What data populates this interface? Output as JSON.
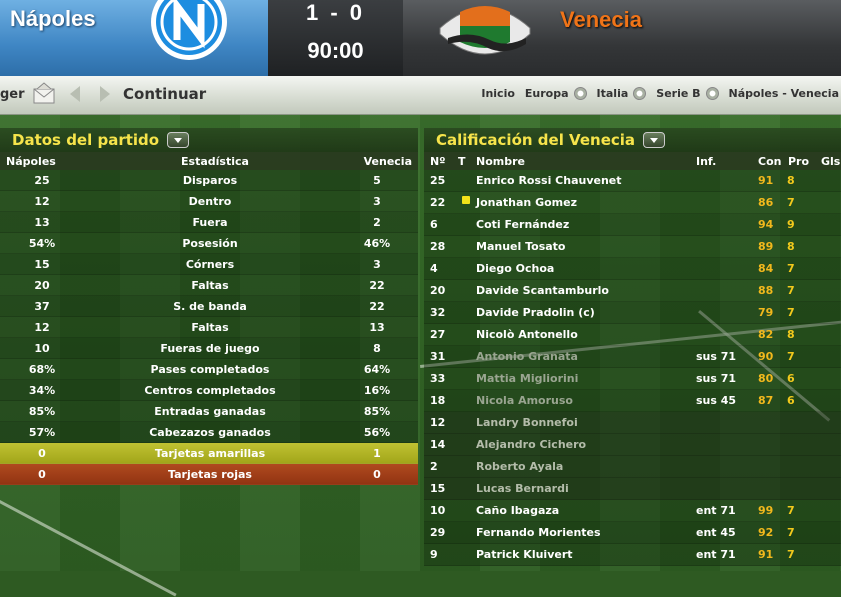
{
  "scoreboard": {
    "home_team": "Nápoles",
    "away_team": "Venecia",
    "score": "1 - 0",
    "clock": "90:00",
    "colors": {
      "home": "#3f86c4",
      "away_text": "#f07418"
    }
  },
  "nav": {
    "manager_fragment": "ger",
    "continue_label": "Continuar",
    "breadcrumbs": [
      "Inicio",
      "Europa",
      "Italia",
      "Serie B",
      "Nápoles - Venecia"
    ]
  },
  "stats_panel": {
    "title": "Datos del partido",
    "headers": {
      "home": "Nápoles",
      "stat": "Estadística",
      "away": "Venecia"
    },
    "rows": [
      {
        "home": "25",
        "stat": "Disparos",
        "away": "5"
      },
      {
        "home": "12",
        "stat": "Dentro",
        "away": "3"
      },
      {
        "home": "13",
        "stat": "Fuera",
        "away": "2"
      },
      {
        "home": "54%",
        "stat": "Posesión",
        "away": "46%"
      },
      {
        "home": "15",
        "stat": "Córners",
        "away": "3"
      },
      {
        "home": "20",
        "stat": "Faltas",
        "away": "22"
      },
      {
        "home": "37",
        "stat": "S. de banda",
        "away": "22"
      },
      {
        "home": "12",
        "stat": "Faltas",
        "away": "13"
      },
      {
        "home": "10",
        "stat": "Fueras de juego",
        "away": "8"
      },
      {
        "home": "68%",
        "stat": "Pases completados",
        "away": "64%"
      },
      {
        "home": "34%",
        "stat": "Centros completados",
        "away": "16%"
      },
      {
        "home": "85%",
        "stat": "Entradas ganadas",
        "away": "85%"
      },
      {
        "home": "57%",
        "stat": "Cabezazos ganados",
        "away": "56%"
      },
      {
        "home": "0",
        "stat": "Tarjetas amarillas",
        "away": "1",
        "highlight": "yellow"
      },
      {
        "home": "0",
        "stat": "Tarjetas rojas",
        "away": "0",
        "highlight": "red"
      }
    ]
  },
  "ratings_panel": {
    "title": "Calificación del Venecia",
    "headers": {
      "num": "Nº",
      "t": "T",
      "name": "Nombre",
      "inf": "Inf.",
      "con": "Con",
      "pro": "Pro",
      "gls": "Gls"
    },
    "players": [
      {
        "num": "25",
        "name": "Enrico Rossi Chauvenet",
        "inf": "",
        "con": "91",
        "pro": "8",
        "state": "starter"
      },
      {
        "num": "22",
        "name": "Jonathan Gomez",
        "inf": "",
        "con": "86",
        "pro": "7",
        "state": "starter",
        "yellow_card": true
      },
      {
        "num": "6",
        "name": "Coti Fernández",
        "inf": "",
        "con": "94",
        "pro": "9",
        "state": "starter"
      },
      {
        "num": "28",
        "name": "Manuel Tosato",
        "inf": "",
        "con": "89",
        "pro": "8",
        "state": "starter"
      },
      {
        "num": "4",
        "name": "Diego Ochoa",
        "inf": "",
        "con": "84",
        "pro": "7",
        "state": "starter"
      },
      {
        "num": "20",
        "name": "Davide Scantamburlo",
        "inf": "",
        "con": "88",
        "pro": "7",
        "state": "starter"
      },
      {
        "num": "32",
        "name": "Davide Pradolin (c)",
        "inf": "",
        "con": "79",
        "pro": "7",
        "state": "starter"
      },
      {
        "num": "27",
        "name": "Nicolò Antonello",
        "inf": "",
        "con": "82",
        "pro": "8",
        "state": "starter"
      },
      {
        "num": "31",
        "name": "Antonio Granata",
        "inf": "sus 71",
        "con": "90",
        "pro": "7",
        "state": "subbed"
      },
      {
        "num": "33",
        "name": "Mattia Migliorini",
        "inf": "sus 71",
        "con": "80",
        "pro": "6",
        "state": "subbed"
      },
      {
        "num": "18",
        "name": "Nicola Amoruso",
        "inf": "sus 45",
        "con": "87",
        "pro": "6",
        "state": "subbed"
      },
      {
        "num": "12",
        "name": "Landry Bonnefoi",
        "inf": "",
        "con": "",
        "pro": "",
        "state": "bench"
      },
      {
        "num": "14",
        "name": "Alejandro Cichero",
        "inf": "",
        "con": "",
        "pro": "",
        "state": "bench"
      },
      {
        "num": "2",
        "name": "Roberto Ayala",
        "inf": "",
        "con": "",
        "pro": "",
        "state": "bench"
      },
      {
        "num": "15",
        "name": "Lucas Bernardi",
        "inf": "",
        "con": "",
        "pro": "",
        "state": "bench"
      },
      {
        "num": "10",
        "name": "Caño Ibagaza",
        "inf": "ent 71",
        "con": "99",
        "pro": "7",
        "state": "starter"
      },
      {
        "num": "29",
        "name": "Fernando Morientes",
        "inf": "ent 45",
        "con": "92",
        "pro": "7",
        "state": "starter"
      },
      {
        "num": "9",
        "name": "Patrick Kluivert",
        "inf": "ent 71",
        "con": "91",
        "pro": "7",
        "state": "starter"
      }
    ]
  }
}
